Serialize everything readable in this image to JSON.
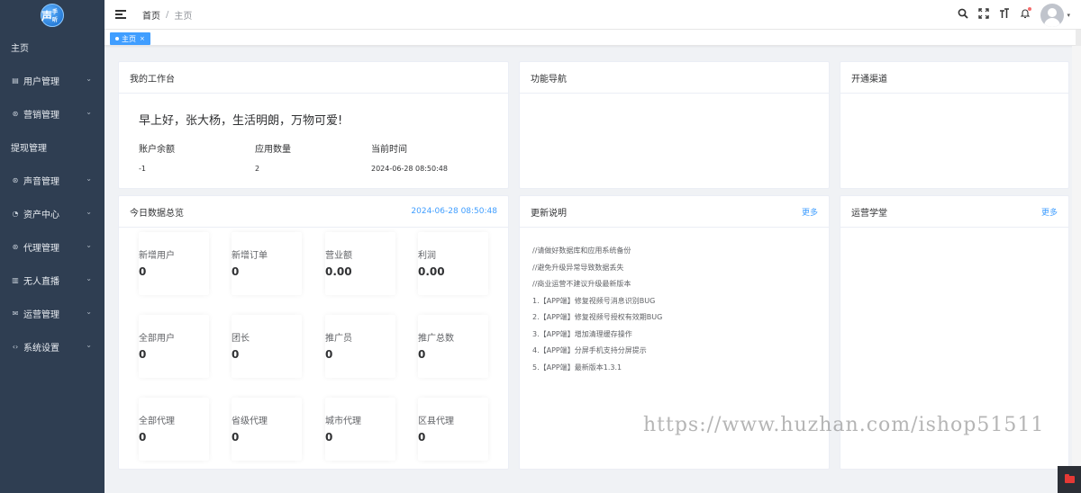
{
  "app": {
    "logo_text": "声",
    "logo_sub": "手听",
    "brand_color": "#2f3e52",
    "accent_color": "#409eff"
  },
  "sidebar": {
    "items": [
      {
        "label": "主页",
        "icon": "",
        "has_children": false
      },
      {
        "label": "用户管理",
        "icon": "user-list-icon",
        "has_children": true
      },
      {
        "label": "营销管理",
        "icon": "marketing-icon",
        "has_children": true
      },
      {
        "label": "提现管理",
        "icon": "",
        "has_children": false
      },
      {
        "label": "声音管理",
        "icon": "sound-icon",
        "has_children": true
      },
      {
        "label": "资产中心",
        "icon": "assets-icon",
        "has_children": true
      },
      {
        "label": "代理管理",
        "icon": "agent-icon",
        "has_children": true
      },
      {
        "label": "无人直播",
        "icon": "live-icon",
        "has_children": true
      },
      {
        "label": "运营管理",
        "icon": "mail-icon",
        "has_children": true
      },
      {
        "label": "系统设置",
        "icon": "code-icon",
        "has_children": true
      }
    ]
  },
  "header": {
    "breadcrumb_home": "首页",
    "breadcrumb_sep": "/",
    "breadcrumb_current": "主页"
  },
  "tags": {
    "active_tag": "主页",
    "close_glyph": "×"
  },
  "workbench": {
    "title": "我的工作台",
    "greeting": "早上好，张大杨，生活明朗，万物可爱!",
    "labels": [
      "账户余额",
      "应用数量",
      "当前时间"
    ],
    "values": [
      "-1",
      "2",
      "2024-06-28 08:50:48"
    ]
  },
  "nav_card": {
    "title": "功能导航"
  },
  "channel_card": {
    "title": "开通渠道"
  },
  "today": {
    "title": "今日数据总览",
    "time": "2024-06-28 08:50:48",
    "stats": [
      {
        "label": "新增用户",
        "value": "0"
      },
      {
        "label": "新增订单",
        "value": "0"
      },
      {
        "label": "营业额",
        "value": "0.00"
      },
      {
        "label": "利润",
        "value": "0.00"
      },
      {
        "label": "全部用户",
        "value": "0"
      },
      {
        "label": "团长",
        "value": "0"
      },
      {
        "label": "推广员",
        "value": "0"
      },
      {
        "label": "推广总数",
        "value": "0"
      },
      {
        "label": "全部代理",
        "value": "0"
      },
      {
        "label": "省级代理",
        "value": "0"
      },
      {
        "label": "城市代理",
        "value": "0"
      },
      {
        "label": "区县代理",
        "value": "0"
      }
    ]
  },
  "updates": {
    "title": "更新说明",
    "more": "更多",
    "notes": [
      "//请做好数据库和应用系统备份",
      "//避免升级异常导致数据丢失",
      "//商业运营不建议升级最新版本",
      "1.【APP端】修复视频号消息识别BUG",
      "2.【APP端】修复视频号授权有效期BUG",
      "3.【APP端】增加清理缓存操作",
      "4.【APP端】分屏手机支持分屏提示",
      "5.【APP端】最新版本1.3.1"
    ]
  },
  "ops_school": {
    "title": "运营学堂",
    "more": "更多"
  },
  "watermark": "https://www.huzhan.com/ishop51511"
}
